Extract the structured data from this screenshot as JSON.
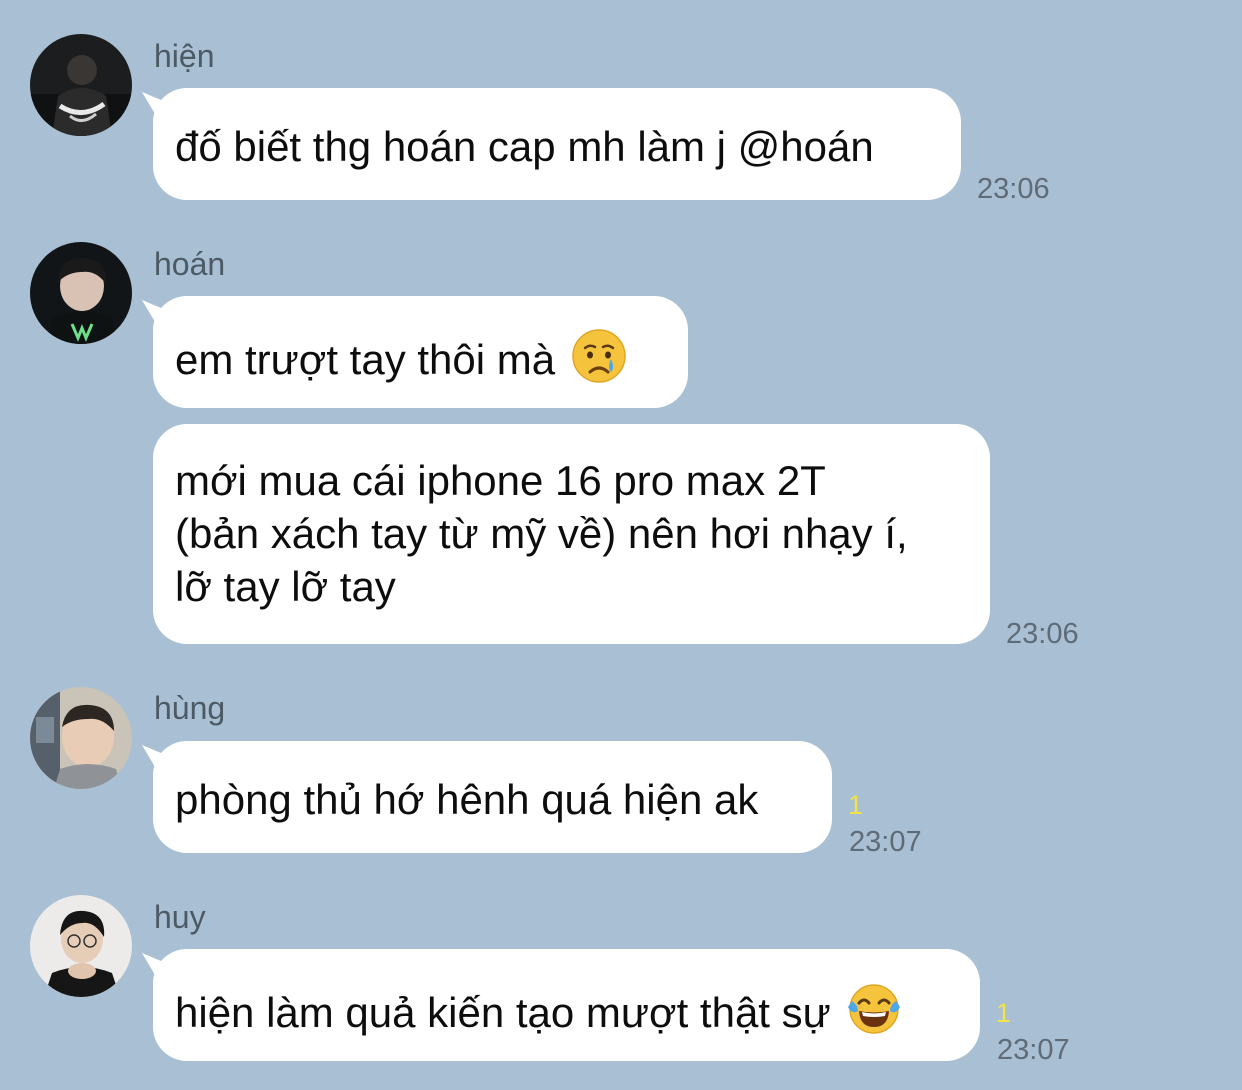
{
  "messages": [
    {
      "sender": "hiện",
      "text": "đố biết thg hoán cap mh làm j @hoán",
      "time": "23:06"
    },
    {
      "sender": "hoán",
      "text": "em trượt tay thôi mà",
      "emoji": "crying-face",
      "time": ""
    },
    {
      "sender": "hoán",
      "lines": [
        "mới mua cái iphone 16 pro max 2T",
        "(bản xách tay từ mỹ về) nên hơi nhạy í,",
        "lỡ tay lỡ tay"
      ],
      "time": "23:06"
    },
    {
      "sender": "hùng",
      "text": "phòng thủ hớ hênh quá hiện ak",
      "read_count": "1",
      "time": "23:07"
    },
    {
      "sender": "huy",
      "text": "hiện làm quả kiến tạo mượt thật sự",
      "emoji": "face-with-tears-of-joy",
      "read_count": "1",
      "time": "23:07"
    }
  ],
  "colors": {
    "background": "#a9bfd3",
    "bubble": "#ffffff",
    "sender_text": "#4c5a66",
    "time_text": "#5f6c78",
    "read_count": "#f2e34a"
  }
}
